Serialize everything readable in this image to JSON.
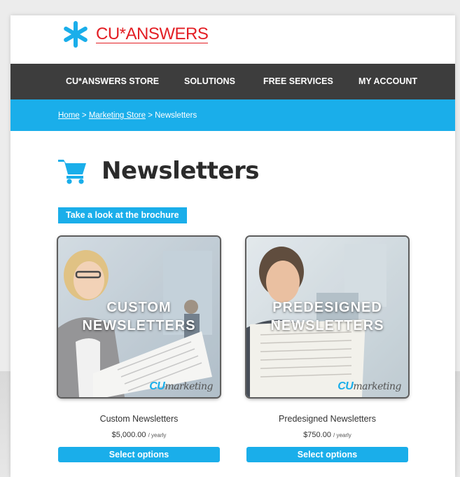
{
  "brand": {
    "logo_text": "CU*ANSWERS",
    "accent_color": "#1aaeea",
    "logo_color": "#e31e24"
  },
  "nav": {
    "items": [
      {
        "label": "CU*ANSWERS STORE"
      },
      {
        "label": "SOLUTIONS"
      },
      {
        "label": "FREE SERVICES"
      },
      {
        "label": "MY ACCOUNT"
      }
    ]
  },
  "breadcrumb": {
    "home": "Home",
    "sep1": ">",
    "store": "Marketing Store",
    "sep2": ">",
    "current": "Newsletters"
  },
  "page": {
    "title": "Newsletters",
    "cart_icon": "shopping-cart-icon",
    "brochure_label": "Take a look at the brochure"
  },
  "products": [
    {
      "overlay_line1": "CUSTOM",
      "overlay_line2": "NEWSLETTERS",
      "watermark_a": "CU",
      "watermark_b": "marketing",
      "name": "Custom Newsletters",
      "price": "$5,000.00",
      "period": "/ yearly",
      "button": "Select options"
    },
    {
      "overlay_line1": "PREDESIGNED",
      "overlay_line2": "NEWSLETTERS",
      "watermark_a": "CU",
      "watermark_b": "marketing",
      "name": "Predesigned Newsletters",
      "price": "$750.00",
      "period": "/ yearly",
      "button": "Select options"
    }
  ]
}
